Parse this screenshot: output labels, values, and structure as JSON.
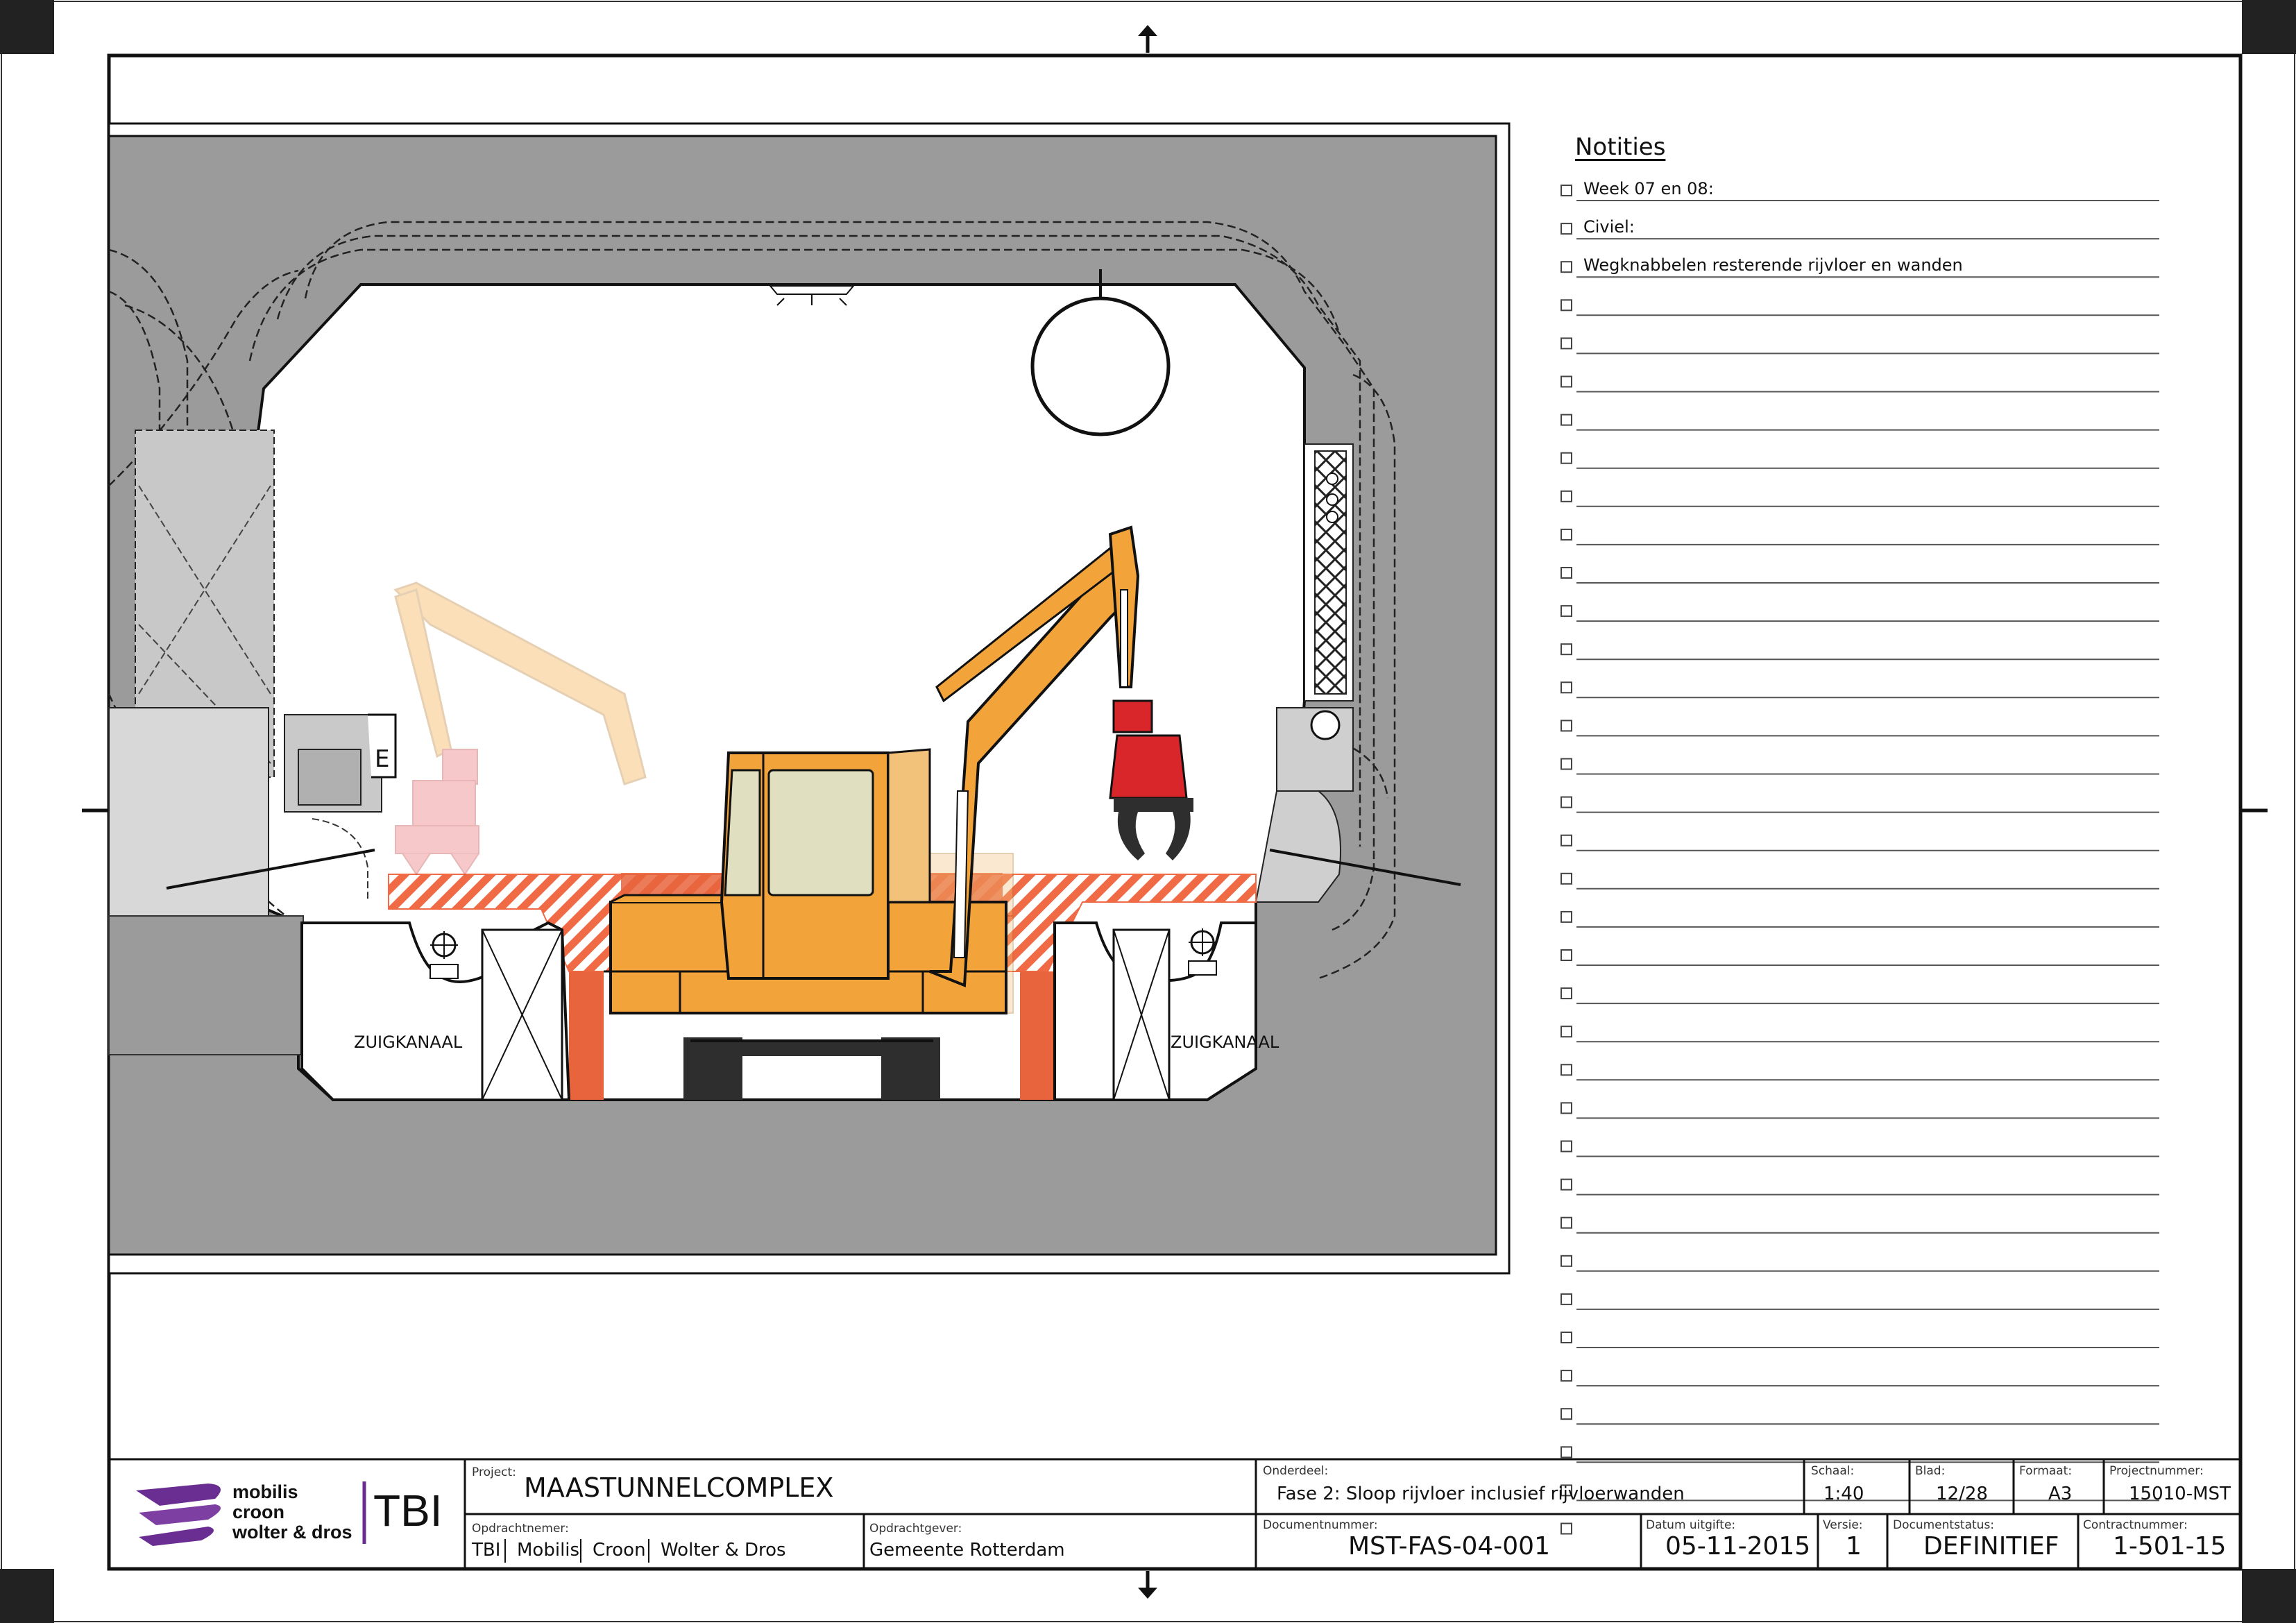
{
  "notes": {
    "title": "Notities",
    "items": [
      "Week 07 en 08:",
      "Civiel:",
      "Wegknabbelen resterende rijvloer en wanden",
      "",
      "",
      "",
      "",
      "",
      "",
      "",
      "",
      "",
      "",
      "",
      "",
      "",
      "",
      "",
      "",
      "",
      "",
      "",
      "",
      "",
      "",
      "",
      "",
      "",
      "",
      "",
      "",
      "",
      "",
      "",
      "",
      ""
    ]
  },
  "drawing": {
    "label_left": "ZUIGKANAAL",
    "label_right": "ZUIGKANAAL"
  },
  "title_block": {
    "logo_lines": [
      "mobilis",
      "croon",
      "wolter & dros"
    ],
    "logo_tbi": "TBI",
    "project_label": "Project:",
    "project_value": "MAASTUNNELCOMPLEX",
    "opdrachtnemer_label": "Opdrachtnemer:",
    "opdrachtnemer_values": [
      "TBI",
      "Mobilis",
      "Croon",
      "Wolter & Dros"
    ],
    "opdrachtgever_label": "Opdrachtgever:",
    "opdrachtgever_value": "Gemeente Rotterdam",
    "onderdeel_label": "Onderdeel:",
    "onderdeel_value": "Fase 2: Sloop rijvloer inclusief rijvloerwanden",
    "schaal_label": "Schaal:",
    "schaal_value": "1:40",
    "blad_label": "Blad:",
    "blad_value": "12/28",
    "formaat_label": "Formaat:",
    "formaat_value": "A3",
    "projectnummer_label": "Projectnummer:",
    "projectnummer_value": "15010-MST",
    "documentnummer_label": "Documentnummer:",
    "documentnummer_value": "MST-FAS-04-001",
    "datum_label": "Datum uitgifte:",
    "datum_value": "05-11-2015",
    "versie_label": "Versie:",
    "versie_value": "1",
    "status_label": "Documentstatus:",
    "status_value": "DEFINITIEF",
    "contractnummer_label": "Contractnummer:",
    "contractnummer_value": "1-501-15"
  },
  "colors": {
    "concrete": "#9b9b9b",
    "excavator": "#f2a43a",
    "demolition_red": "#e8643c",
    "hatch": "#ef6a45",
    "gripper": "#d9262b",
    "logo_purple": "#6a2d91"
  }
}
